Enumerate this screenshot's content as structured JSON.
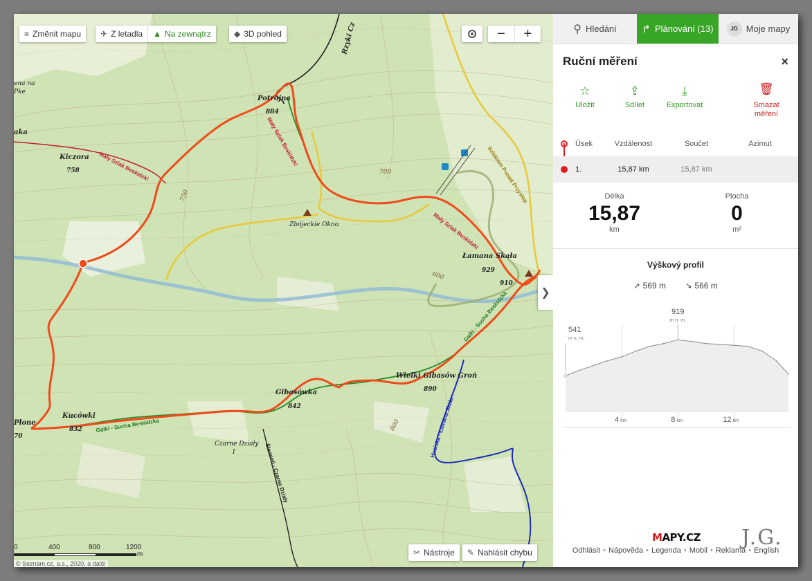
{
  "map_toolbar": {
    "change_map": "Změnit mapu",
    "from_plane": "Z letadla",
    "outdoor": "Na zewnątrz",
    "view_3d": "3D pohled",
    "tools": "Nástroje",
    "report_error": "Nahlásit chybu",
    "collapse_glyph": "❯"
  },
  "scale": {
    "labels": [
      "0",
      "400",
      "800",
      "1200"
    ],
    "unit": "m"
  },
  "copyright": "© Seznam.cz, a.s., 2020, a další",
  "map_labels": {
    "kiczora": "Kiczora",
    "kiczora_elev": "758",
    "potrojna": "Potrojna",
    "potrojna_elev": "884",
    "zbojeckie": "Zbójeckie Okno",
    "lamana": "Łamana Skała",
    "lamana_elev": "929",
    "p910": "910",
    "wielki": "Wielki Gibasów Groń",
    "wielki_elev": "890",
    "gibasowka": "Gibasówka",
    "gibasowka_elev": "842",
    "kucowki": "Kucówki",
    "kucowki_elev": "832",
    "czarne": "Czarne Działy",
    "czarne_sub": "I",
    "plone": "Płone",
    "plone_elev": "70",
    "laka": "aka",
    "lena": "ena na",
    "pke": "Pke",
    "rzyki": "Rzyki Cz",
    "trail_maly1": "Mały Szlak Beskidzki",
    "trail_maly2": "Mały Szlak Beskidzki",
    "trail_maly3": "Mały Szlak Beskidzki",
    "trail_gaiki1": "Gaiki - Sucha Beskidzka",
    "trail_gaiki2": "Gaiki - Sucha Beskidzka",
    "trail_slemien": "Ślemień - Czarne Działy",
    "trail_huciska": "Huciska - Łamana Skała",
    "trail_szlak": "Szlakiem Ponad Przysłop",
    "contour_700": "700",
    "contour_750": "750",
    "contour_800": "800",
    "contour_600": "600"
  },
  "tabs": {
    "search": "Hledání",
    "planning": "Plánování (13)",
    "avatar": "JG",
    "my_maps": "Moje mapy"
  },
  "panel": {
    "title": "Ruční měření",
    "close": "×",
    "actions": {
      "save": "Uložit",
      "share": "Sdílet",
      "export": "Exportovat",
      "delete_line1": "Smazat",
      "delete_line2": "měření"
    },
    "table_headers": {
      "segment": "Úsek",
      "distance": "Vzdálenost",
      "sum": "Součet",
      "azimuth": "Azimut"
    },
    "rows": [
      {
        "segment": "1.",
        "distance": "15,87 km",
        "sum": "15,87 km",
        "azimuth": ""
      }
    ],
    "length_label": "Délka",
    "length_value": "15,87",
    "length_unit": "km",
    "area_label": "Plocha",
    "area_value": "0",
    "area_unit": "m²",
    "profile_title": "Výškový profil",
    "ascent": "569 m",
    "descent": "566 m"
  },
  "chart_data": {
    "type": "area",
    "title": "Výškový profil",
    "x": [
      0,
      1,
      2,
      3,
      4,
      5,
      6,
      7,
      8,
      9,
      10,
      11,
      12,
      13,
      14,
      15,
      15.87
    ],
    "y": [
      541,
      600,
      650,
      700,
      740,
      800,
      850,
      880,
      919,
      900,
      880,
      870,
      860,
      850,
      800,
      700,
      560
    ],
    "x_ticks": [
      "4 km",
      "8 km",
      "12 km"
    ],
    "max_label": "919",
    "max_unit": "m n. m.",
    "start_label": "541",
    "start_unit": "m n. m.",
    "xlim": [
      0,
      15.87
    ],
    "ylim": [
      450,
      1000
    ]
  },
  "footer": {
    "links": [
      "Odhlásit",
      "Nápověda",
      "Legenda",
      "Mobil",
      "Reklama",
      "English"
    ],
    "logo_m": "M",
    "logo_rest": "APY.CZ",
    "signature": "J.G."
  },
  "colors": {
    "route": "#f04a1a",
    "accent_green": "#38a526",
    "trail_red": "#c0202a",
    "trail_green": "#1d7a1d",
    "trail_blue": "#1b2bb5",
    "river": "#8fb9d6"
  }
}
